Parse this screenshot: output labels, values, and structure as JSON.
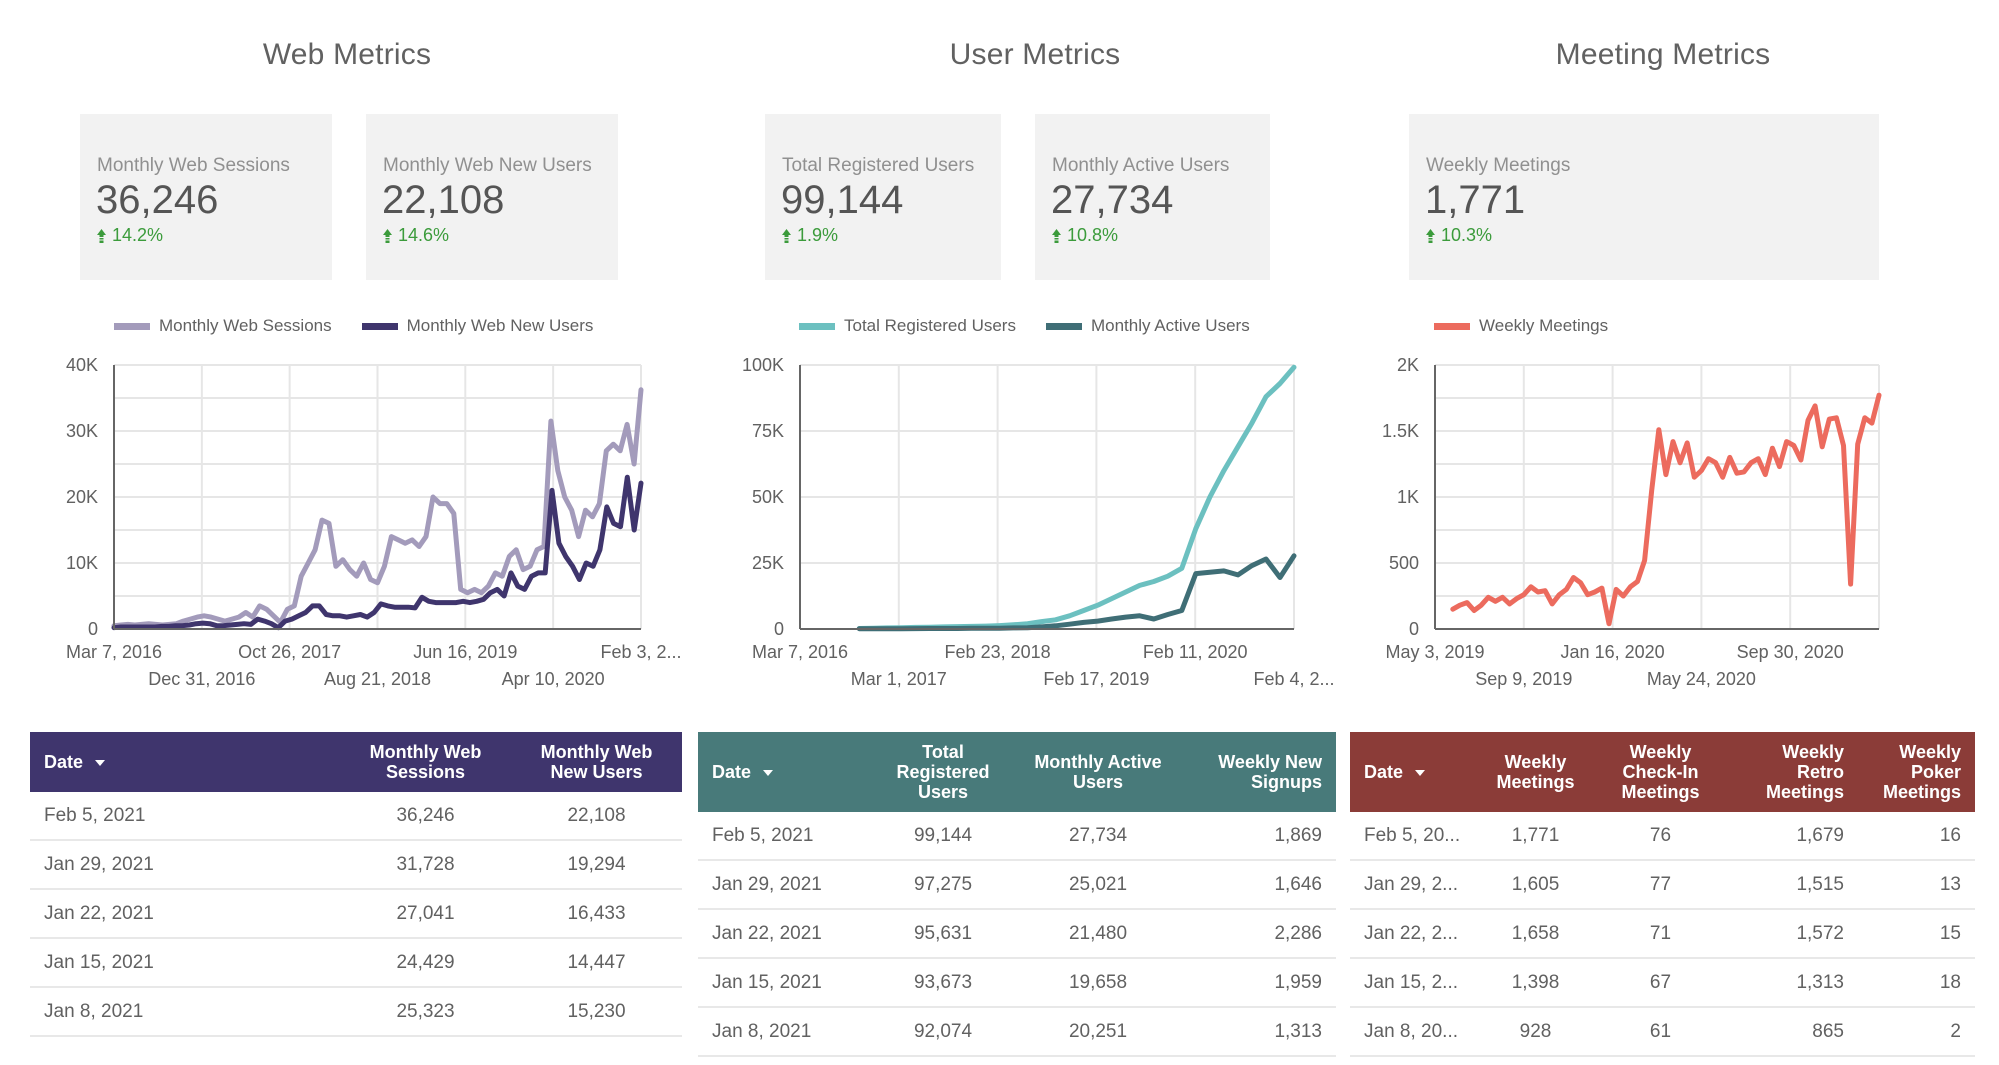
{
  "sections": {
    "web": {
      "title": "Web Metrics",
      "cards": [
        {
          "label": "Monthly Web Sessions",
          "value": "36,246",
          "delta": "14.2%",
          "trend": "up"
        },
        {
          "label": "Monthly Web New Users",
          "value": "22,108",
          "delta": "14.6%",
          "trend": "up"
        }
      ],
      "table": {
        "header_color": "#3f356d",
        "columns": [
          "Date",
          "Monthly Web Sessions",
          "Monthly Web New Users"
        ],
        "sorted_column": "Date",
        "rows": [
          [
            "Feb 5, 2021",
            "36,246",
            "22,108"
          ],
          [
            "Jan 29, 2021",
            "31,728",
            "19,294"
          ],
          [
            "Jan 22, 2021",
            "27,041",
            "16,433"
          ],
          [
            "Jan 15, 2021",
            "24,429",
            "14,447"
          ],
          [
            "Jan 8, 2021",
            "25,323",
            "15,230"
          ]
        ]
      }
    },
    "user": {
      "title": "User Metrics",
      "cards": [
        {
          "label": "Total Registered Users",
          "value": "99,144",
          "delta": "1.9%",
          "trend": "up"
        },
        {
          "label": "Monthly Active Users",
          "value": "27,734",
          "delta": "10.8%",
          "trend": "up"
        }
      ],
      "table": {
        "header_color": "#487a7a",
        "columns": [
          "Date",
          "Total Registered Users",
          "Monthly Active Users",
          "Weekly New Signups"
        ],
        "sorted_column": "Date",
        "rows": [
          [
            "Feb 5, 2021",
            "99,144",
            "27,734",
            "1,869"
          ],
          [
            "Jan 29, 2021",
            "97,275",
            "25,021",
            "1,646"
          ],
          [
            "Jan 22, 2021",
            "95,631",
            "21,480",
            "2,286"
          ],
          [
            "Jan 15, 2021",
            "93,673",
            "19,658",
            "1,959"
          ],
          [
            "Jan 8, 2021",
            "92,074",
            "20,251",
            "1,313"
          ]
        ]
      }
    },
    "meeting": {
      "title": "Meeting Metrics",
      "cards": [
        {
          "label": "Weekly Meetings",
          "value": "1,771",
          "delta": "10.3%",
          "trend": "up"
        }
      ],
      "table": {
        "header_color": "#8b3c38",
        "columns": [
          "Date",
          "Weekly Meetings",
          "Weekly Check-In Meetings",
          "Weekly Retro Meetings",
          "Weekly Poker Meetings"
        ],
        "sorted_column": "Date",
        "rows": [
          [
            "Feb 5, 20...",
            "1,771",
            "76",
            "1,679",
            "16"
          ],
          [
            "Jan 29, 2...",
            "1,605",
            "77",
            "1,515",
            "13"
          ],
          [
            "Jan 22, 2...",
            "1,658",
            "71",
            "1,572",
            "15"
          ],
          [
            "Jan 15, 2...",
            "1,398",
            "67",
            "1,313",
            "18"
          ],
          [
            "Jan 8, 20...",
            "928",
            "61",
            "865",
            "2"
          ]
        ]
      }
    }
  },
  "delta_color": "#3b9b3b",
  "chart_data": [
    {
      "id": "web",
      "type": "line",
      "title": "",
      "xlabel": "",
      "ylabel": "",
      "ylim": [
        0,
        40000
      ],
      "yticks": [
        "0",
        "10K",
        "20K",
        "30K",
        "40K"
      ],
      "minor_grid_step": 5000,
      "grid": true,
      "legend": "top",
      "x_range": [
        "Mar 7, 2016",
        "Feb 5, 2021"
      ],
      "xtick_labels_row1": [
        "Mar 7, 2016",
        "Oct 26, 2017",
        "Jun 16, 2019",
        "Feb 3, 2..."
      ],
      "xtick_labels_row2": [
        "Dec 31, 2016",
        "Aug 21, 2018",
        "Apr 10, 2020"
      ],
      "series": [
        {
          "name": "Monthly Web Sessions",
          "color": "#a39bbb",
          "values": [
            500,
            600,
            700,
            600,
            700,
            800,
            700,
            600,
            700,
            800,
            1200,
            1500,
            1800,
            2000,
            1800,
            1500,
            1200,
            1500,
            1800,
            2500,
            1800,
            3500,
            3000,
            2000,
            1000,
            3000,
            3500,
            8000,
            10000,
            12000,
            16500,
            16000,
            9500,
            10500,
            9000,
            8000,
            10000,
            7500,
            7000,
            9500,
            14000,
            13500,
            13000,
            13500,
            12500,
            14000,
            20000,
            19000,
            19000,
            17500,
            6000,
            5500,
            6000,
            5500,
            6500,
            8500,
            8000,
            11000,
            12000,
            9000,
            9500,
            12000,
            12500,
            31500,
            24000,
            20000,
            18000,
            14000,
            18000,
            17000,
            19000,
            27000,
            28000,
            27000,
            31000,
            25000,
            36246
          ]
        },
        {
          "name": "Monthly Web New Users",
          "color": "#3f356d",
          "values": [
            200,
            300,
            300,
            300,
            300,
            300,
            300,
            400,
            400,
            500,
            500,
            600,
            800,
            900,
            800,
            500,
            500,
            600,
            700,
            800,
            700,
            1500,
            1200,
            800,
            200,
            1200,
            1500,
            2000,
            2500,
            3500,
            3500,
            2200,
            2000,
            2000,
            1800,
            2000,
            2200,
            1800,
            2500,
            3800,
            3500,
            3300,
            3300,
            3300,
            3200,
            4800,
            4200,
            4000,
            4000,
            4000,
            4000,
            4200,
            4000,
            4200,
            4500,
            5500,
            6000,
            5000,
            8500,
            6500,
            6000,
            8000,
            8500,
            8500,
            21000,
            13000,
            11000,
            9500,
            7500,
            10000,
            9500,
            12000,
            18500,
            16000,
            15500,
            23000,
            15000,
            22108
          ]
        }
      ]
    },
    {
      "id": "user",
      "type": "line",
      "title": "",
      "xlabel": "",
      "ylabel": "",
      "ylim": [
        0,
        100000
      ],
      "yticks": [
        "0",
        "25K",
        "50K",
        "75K",
        "100K"
      ],
      "grid": true,
      "legend": "top",
      "x_range": [
        "Mar 7, 2016",
        "Feb 5, 2021"
      ],
      "xtick_labels_row1": [
        "Mar 7, 2016",
        "Feb 23, 2018",
        "Feb 11, 2020"
      ],
      "xtick_labels_row2": [
        "Mar 1, 2017",
        "Feb 17, 2019",
        "Feb 4, 2..."
      ],
      "series": [
        {
          "name": "Total Registered Users",
          "color": "#6cc0c0",
          "start_fraction": 0.12,
          "values": [
            200,
            300,
            400,
            500,
            600,
            700,
            800,
            900,
            1000,
            1100,
            1300,
            1600,
            2000,
            2800,
            3500,
            5000,
            7000,
            9000,
            11500,
            14000,
            16500,
            18000,
            20000,
            23000,
            38000,
            50000,
            60000,
            69000,
            78000,
            88000,
            93000,
            99144
          ]
        },
        {
          "name": "Monthly Active Users",
          "color": "#3f6e76",
          "start_fraction": 0.12,
          "values": [
            100,
            100,
            100,
            100,
            150,
            200,
            200,
            200,
            250,
            300,
            300,
            400,
            500,
            800,
            1200,
            1800,
            2500,
            3000,
            3800,
            4500,
            5000,
            3800,
            5500,
            7000,
            21000,
            21500,
            22000,
            20500,
            24000,
            26500,
            19500,
            27734
          ]
        }
      ]
    },
    {
      "id": "meeting",
      "type": "line",
      "title": "",
      "xlabel": "",
      "ylabel": "",
      "ylim": [
        0,
        2000
      ],
      "yticks": [
        "0",
        "500",
        "1K",
        "1.5K",
        "2K"
      ],
      "minor_grid_step": 250,
      "grid": true,
      "legend": "top",
      "x_range": [
        "May 3, 2019",
        "Feb 5, 2021"
      ],
      "xtick_labels_row1": [
        "May 3, 2019",
        "Jan 16, 2020",
        "Sep 30, 2020"
      ],
      "xtick_labels_row2": [
        "Sep 9, 2019",
        "May 24, 2020"
      ],
      "series": [
        {
          "name": "Weekly Meetings",
          "color": "#ec6b5e",
          "start_fraction": 0.04,
          "values": [
            150,
            180,
            200,
            140,
            180,
            240,
            210,
            240,
            190,
            230,
            260,
            320,
            280,
            290,
            190,
            260,
            300,
            390,
            350,
            260,
            280,
            310,
            40,
            300,
            250,
            320,
            360,
            520,
            1050,
            1510,
            1170,
            1420,
            1260,
            1410,
            1150,
            1200,
            1290,
            1260,
            1150,
            1300,
            1180,
            1190,
            1260,
            1290,
            1170,
            1370,
            1230,
            1420,
            1390,
            1280,
            1580,
            1690,
            1380,
            1590,
            1600,
            1390,
            340,
            1400,
            1600,
            1560,
            1771
          ]
        }
      ]
    }
  ]
}
